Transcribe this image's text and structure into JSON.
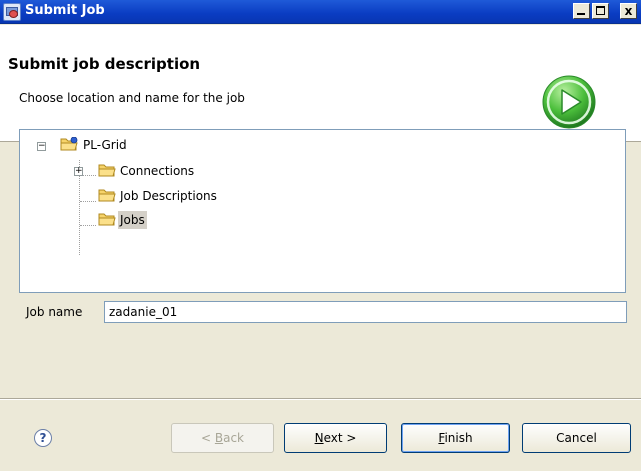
{
  "window": {
    "title": "Submit Job",
    "minimize_glyph": "_",
    "maximize_glyph": "□",
    "close_glyph": "x"
  },
  "header": {
    "title": "Submit job description",
    "subtitle": "Choose location and name for the job",
    "icon": "run-play-icon",
    "icon_color": "#3aa83a"
  },
  "tree": {
    "root": {
      "label": "PL-Grid",
      "expanded": true,
      "icon": "project-folder-icon"
    },
    "children": [
      {
        "label": "Connections",
        "expandable": true,
        "icon": "folder-icon"
      },
      {
        "label": "Job Descriptions",
        "expandable": false,
        "icon": "folder-icon"
      },
      {
        "label": "Jobs",
        "expandable": false,
        "icon": "folder-icon",
        "selected": true
      }
    ]
  },
  "form": {
    "job_name_label": "Job name",
    "job_name_value": "zadanie_01"
  },
  "buttons": {
    "help": "?",
    "back": "< Back",
    "back_mnemonic": "B",
    "next": "Next >",
    "next_mnemonic": "N",
    "finish": "Finish",
    "finish_mnemonic": "F",
    "cancel": "Cancel"
  },
  "colors": {
    "titlebar": "#0a3cc2",
    "folder": "#f6d36a",
    "selection": "#d4d0c8"
  }
}
